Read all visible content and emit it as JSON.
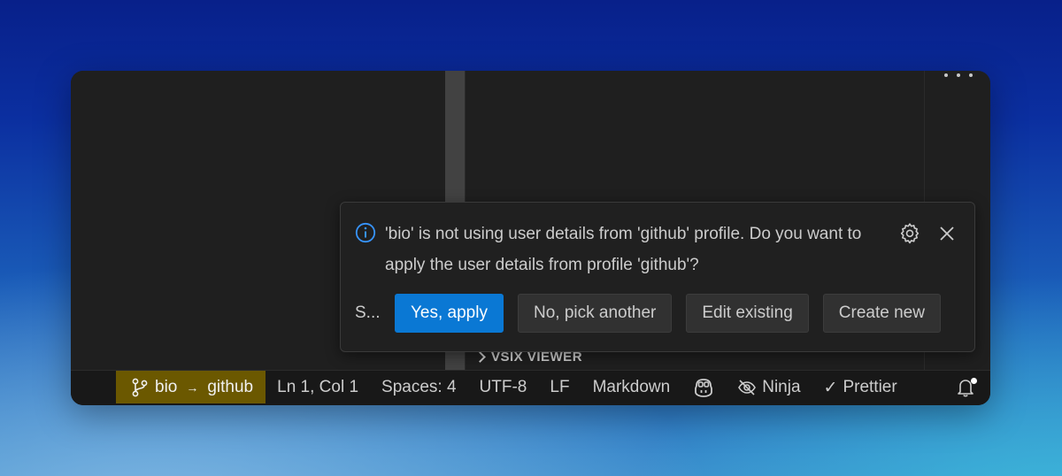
{
  "window": {
    "section_title": "VSIX VIEWER"
  },
  "notification": {
    "icon": "info-icon",
    "message": "'bio' is not using user details from 'github' profile. Do you want to apply the user details from profile 'github'?",
    "source": "S...",
    "buttons": {
      "primary": "Yes, apply",
      "pick_another": "No, pick another",
      "edit_existing": "Edit existing",
      "create_new": "Create new"
    }
  },
  "statusbar": {
    "branch_from": "bio",
    "branch_to": "github",
    "branch_arrow": "→",
    "position": "Ln 1, Col 1",
    "spaces": "Spaces: 4",
    "encoding": "UTF-8",
    "eol": "LF",
    "language": "Markdown",
    "ninja": "Ninja",
    "prettier": "Prettier",
    "prettier_check": "✓"
  },
  "colors": {
    "accent": "#0a78d4",
    "branch_bg": "#6b5800",
    "panel_bg": "#1f1f1f"
  }
}
